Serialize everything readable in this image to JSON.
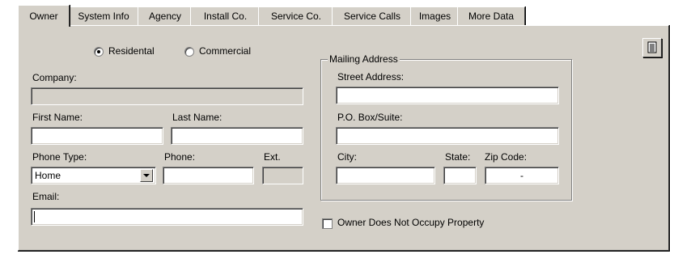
{
  "tabs": [
    {
      "label": "Owner",
      "active": true
    },
    {
      "label": "System Info"
    },
    {
      "label": "Agency"
    },
    {
      "label": "Install Co."
    },
    {
      "label": "Service Co."
    },
    {
      "label": "Service Calls"
    },
    {
      "label": "Images"
    },
    {
      "label": "More Data"
    }
  ],
  "owner_type": {
    "residential_label": "Residental",
    "commercial_label": "Commercial",
    "selected": "residential"
  },
  "form": {
    "company_label": "Company:",
    "company_value": "",
    "first_name_label": "First Name:",
    "first_name_value": "",
    "last_name_label": "Last Name:",
    "last_name_value": "",
    "phone_type_label": "Phone Type:",
    "phone_type_value": "Home",
    "phone_label": "Phone:",
    "phone_value": "",
    "ext_label": "Ext.",
    "ext_value": "",
    "email_label": "Email:",
    "email_value": ""
  },
  "mailing": {
    "group_title": "Mailing Address",
    "street_label": "Street Address:",
    "street_value": "",
    "pobox_label": "P.O. Box/Suite:",
    "pobox_value": "",
    "city_label": "City:",
    "city_value": "",
    "state_label": "State:",
    "state_value": "",
    "zip_label": "Zip Code:",
    "zip_value": "-"
  },
  "occupy": {
    "label": "Owner Does Not Occupy Property",
    "checked": false
  },
  "toolbar": {
    "notes_icon": "notes-icon"
  }
}
